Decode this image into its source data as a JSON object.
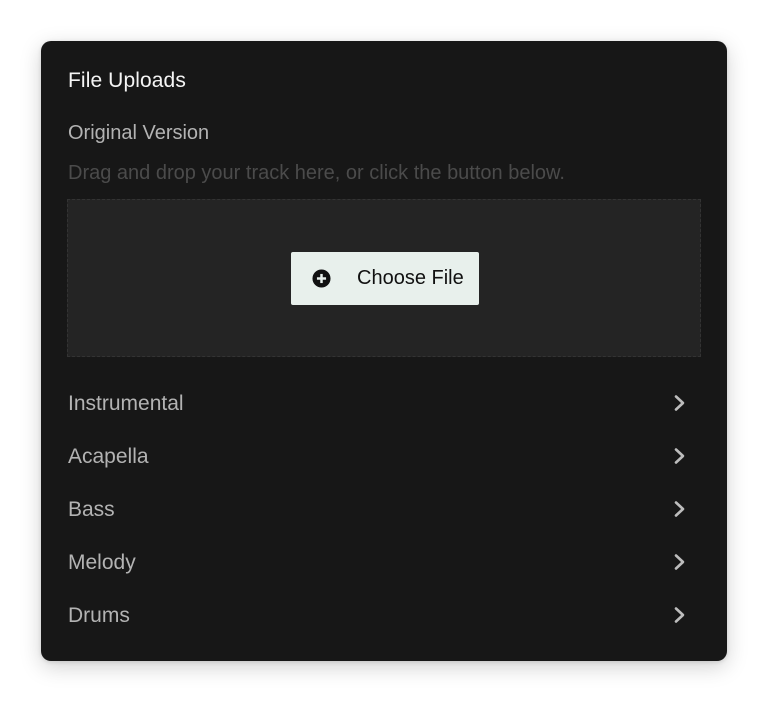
{
  "panel": {
    "title": "File Uploads"
  },
  "original": {
    "label": "Original Version",
    "hint": "Drag and drop your track here, or click the button below.",
    "choose_button": {
      "label": "Choose File",
      "icon": "plus-circle-icon"
    }
  },
  "stems": [
    {
      "label": "Instrumental",
      "icon": "chevron-right-icon"
    },
    {
      "label": "Acapella",
      "icon": "chevron-right-icon"
    },
    {
      "label": "Bass",
      "icon": "chevron-right-icon"
    },
    {
      "label": "Melody",
      "icon": "chevron-right-icon"
    },
    {
      "label": "Drums",
      "icon": "chevron-right-icon"
    }
  ],
  "colors": {
    "card_background": "#171717",
    "dropzone_background": "#242424",
    "button_background": "#e8f0ec",
    "title_text": "#f5f5f5",
    "muted_text": "#b3b3b3",
    "hint_text": "#4b4b4b"
  }
}
